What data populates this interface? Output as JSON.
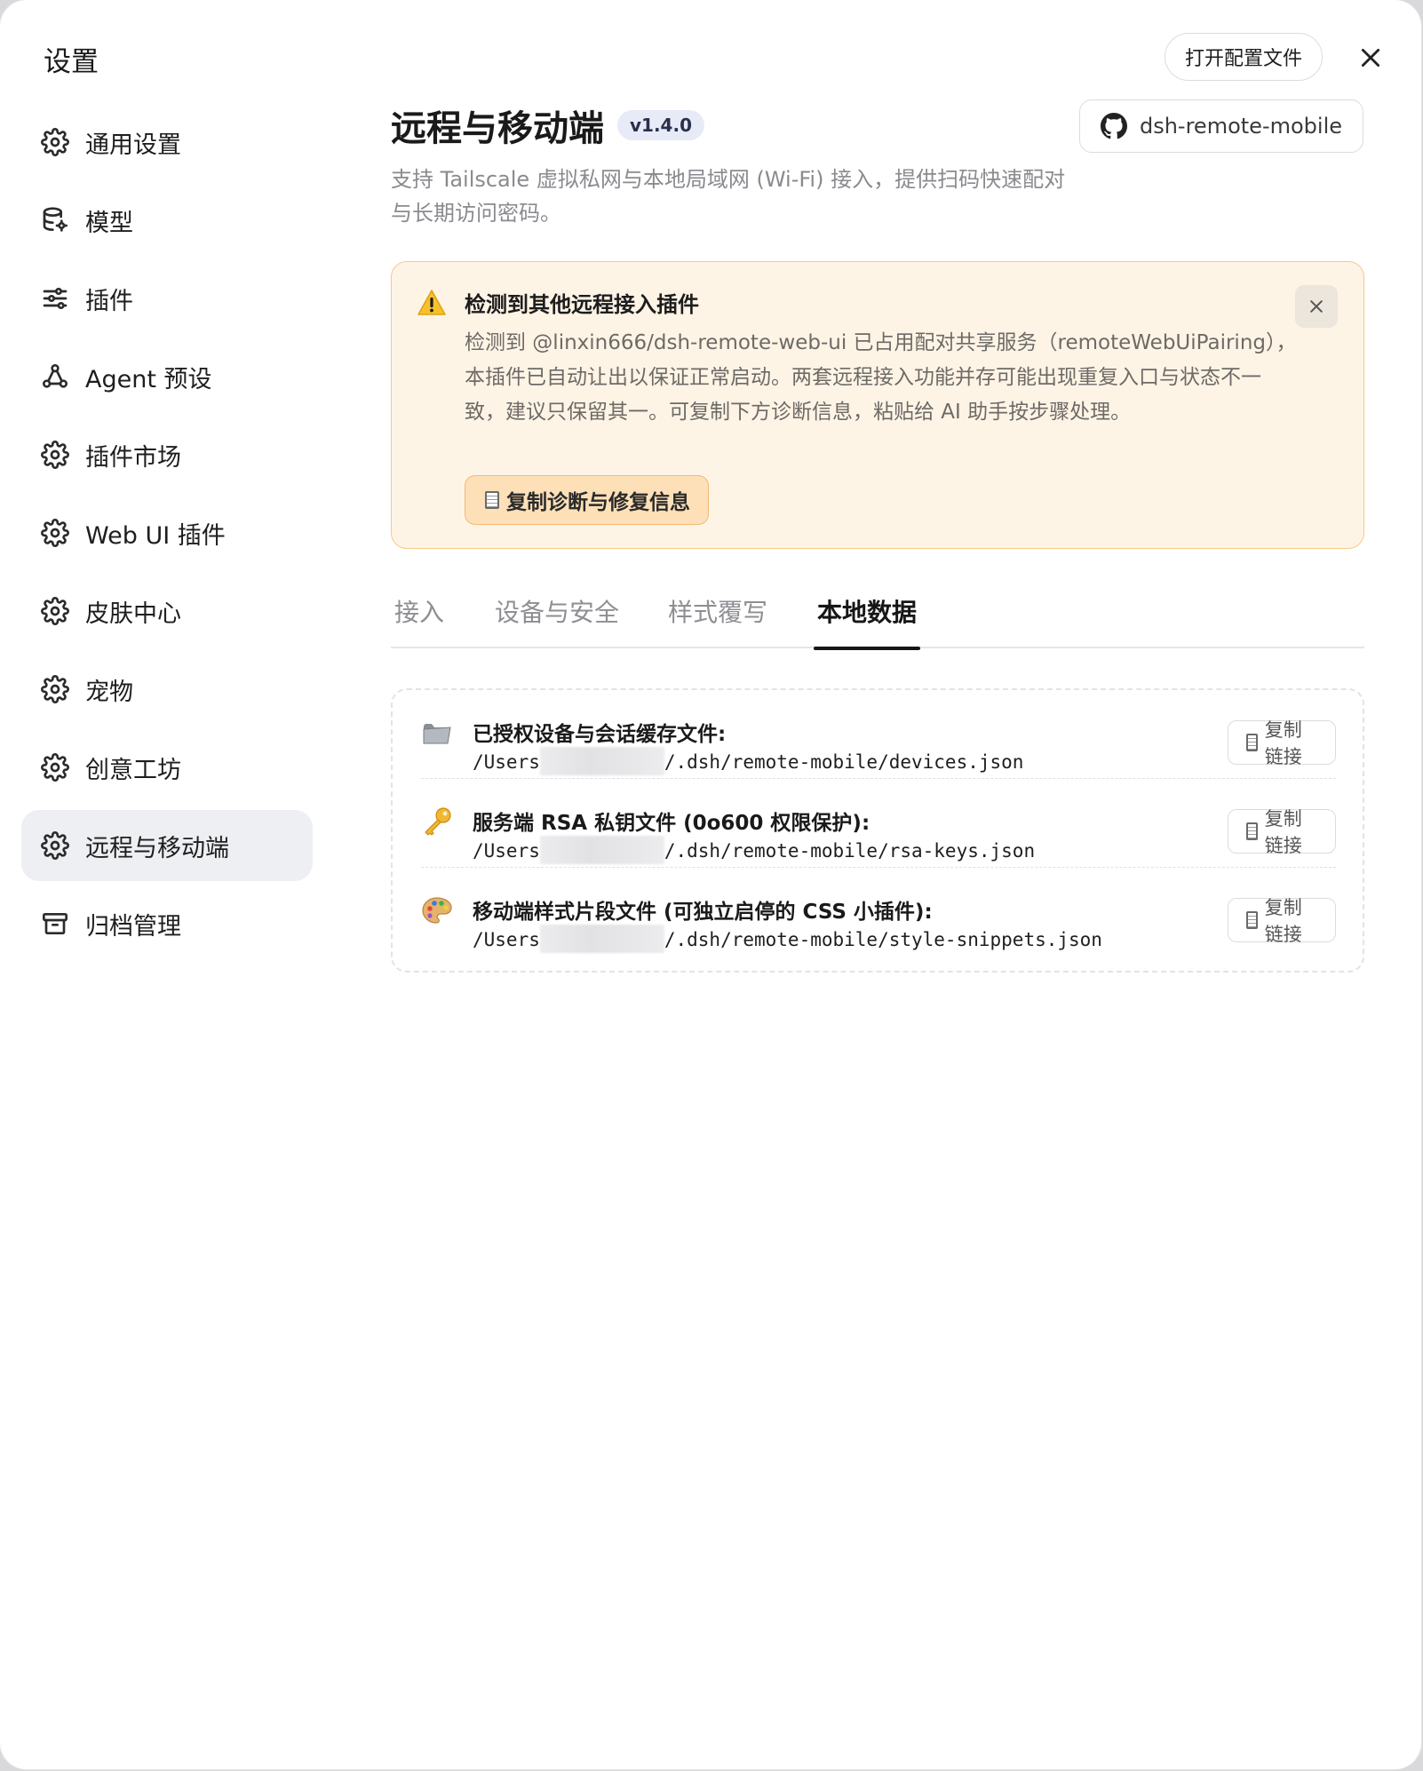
{
  "app": {
    "title": "设置"
  },
  "top": {
    "open_config_label": "打开配置文件"
  },
  "sidebar": {
    "items": [
      {
        "label": "通用设置",
        "icon": "gear-icon"
      },
      {
        "label": "模型",
        "icon": "database-gear-icon"
      },
      {
        "label": "插件",
        "icon": "sliders-icon"
      },
      {
        "label": "Agent 预设",
        "icon": "nodes-icon"
      },
      {
        "label": "插件市场",
        "icon": "gear-icon"
      },
      {
        "label": "Web UI 插件",
        "icon": "gear-icon"
      },
      {
        "label": "皮肤中心",
        "icon": "gear-icon"
      },
      {
        "label": "宠物",
        "icon": "gear-icon"
      },
      {
        "label": "创意工坊",
        "icon": "gear-icon"
      },
      {
        "label": "远程与移动端",
        "icon": "gear-icon",
        "active": true
      },
      {
        "label": "归档管理",
        "icon": "archive-icon"
      }
    ]
  },
  "header": {
    "title": "远程与移动端",
    "version": "v1.4.0",
    "repo_label": "dsh-remote-mobile",
    "subtitle": "支持 Tailscale 虚拟私网与本地局域网 (Wi-Fi) 接入，提供扫码快速配对与长期访问密码。"
  },
  "warning": {
    "title": "检测到其他远程接入插件",
    "body": "检测到 @linxin666/dsh-remote-web-ui 已占用配对共享服务（remoteWebUiPairing），本插件已自动让出以保证正常启动。两套远程接入功能并存可能出现重复入口与状态不一致，建议只保留其一。可复制下方诊断信息，粘贴给 AI 助手按步骤处理。",
    "copy_label": "复制诊断与修复信息",
    "accent": "#f6c98b",
    "background": "#fef4e6"
  },
  "tabs": [
    {
      "label": "接入"
    },
    {
      "label": "设备与安全"
    },
    {
      "label": "样式覆写"
    },
    {
      "label": "本地数据",
      "active": true
    }
  ],
  "files": [
    {
      "icon": "folder-icon",
      "title": "已授权设备与会话缓存文件:",
      "path_prefix": "/Users",
      "path_suffix": "/.dsh/remote-mobile/devices.json",
      "copy_label": "复制链接"
    },
    {
      "icon": "key-icon",
      "title": "服务端 RSA 私钥文件 (0o600 权限保护):",
      "path_prefix": "/Users",
      "path_suffix": "/.dsh/remote-mobile/rsa-keys.json",
      "copy_label": "复制链接"
    },
    {
      "icon": "palette-icon",
      "title": "移动端样式片段文件 (可独立启停的 CSS 小插件):",
      "path_prefix": "/Users",
      "path_suffix": "/.dsh/remote-mobile/style-snippets.json",
      "copy_label": "复制链接"
    }
  ]
}
